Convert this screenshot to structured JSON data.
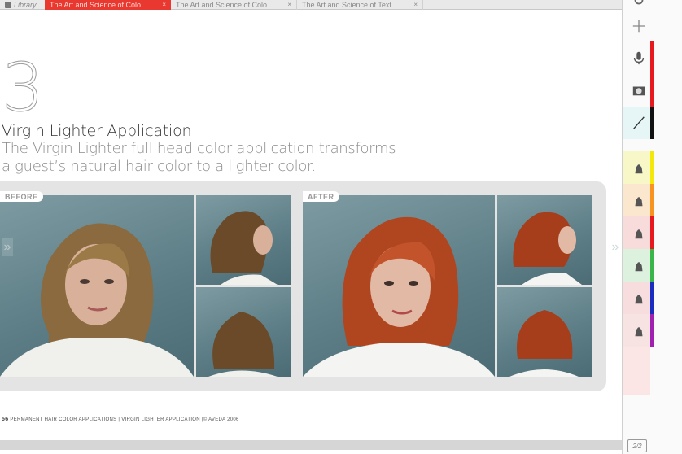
{
  "tabs": {
    "library_label": "Library",
    "items": [
      {
        "label": "The Art and Science of Colo...",
        "close": "×",
        "active": true
      },
      {
        "label": "The Art and Science of Colo",
        "close": "×",
        "active": false
      },
      {
        "label": "The Art and Science of Text...",
        "close": "×",
        "active": false
      }
    ]
  },
  "page": {
    "step_number": "3",
    "title": "Virgin Lighter Application",
    "subtitle": "The Virgin Lighter full head color application transforms a guest’s natural hair color to a lighter color.",
    "before_label": "BEFORE",
    "after_label": "AFTER",
    "footer_page_number": "56",
    "footer_text": "PERMANENT HAIR COLOR APPLICATIONS | VIRGIN LIGHTER APPLICATION |© AVEDA 2006"
  },
  "sidebar": {
    "tools": [
      {
        "name": "add-icon"
      },
      {
        "name": "microphone-icon",
        "color": "#e8191e"
      },
      {
        "name": "camera-icon",
        "color": "#e8191e"
      },
      {
        "name": "pen-icon",
        "color": "#111111"
      },
      {
        "name": "highlighter-yellow-icon",
        "color": "#f4e80a"
      },
      {
        "name": "highlighter-orange-icon",
        "color": "#f7931e"
      },
      {
        "name": "highlighter-red-icon",
        "color": "#e8191e"
      },
      {
        "name": "highlighter-green-icon",
        "color": "#39b54a"
      },
      {
        "name": "highlighter-blue-icon",
        "color": "#1b2cc1"
      },
      {
        "name": "highlighter-purple-icon",
        "color": "#a020b0"
      }
    ],
    "page_counter": "2/2"
  },
  "colors": {
    "active_tab": "#e8382f",
    "panel_bg": "#e4e4e4",
    "backdrop": "#6a8a92"
  }
}
